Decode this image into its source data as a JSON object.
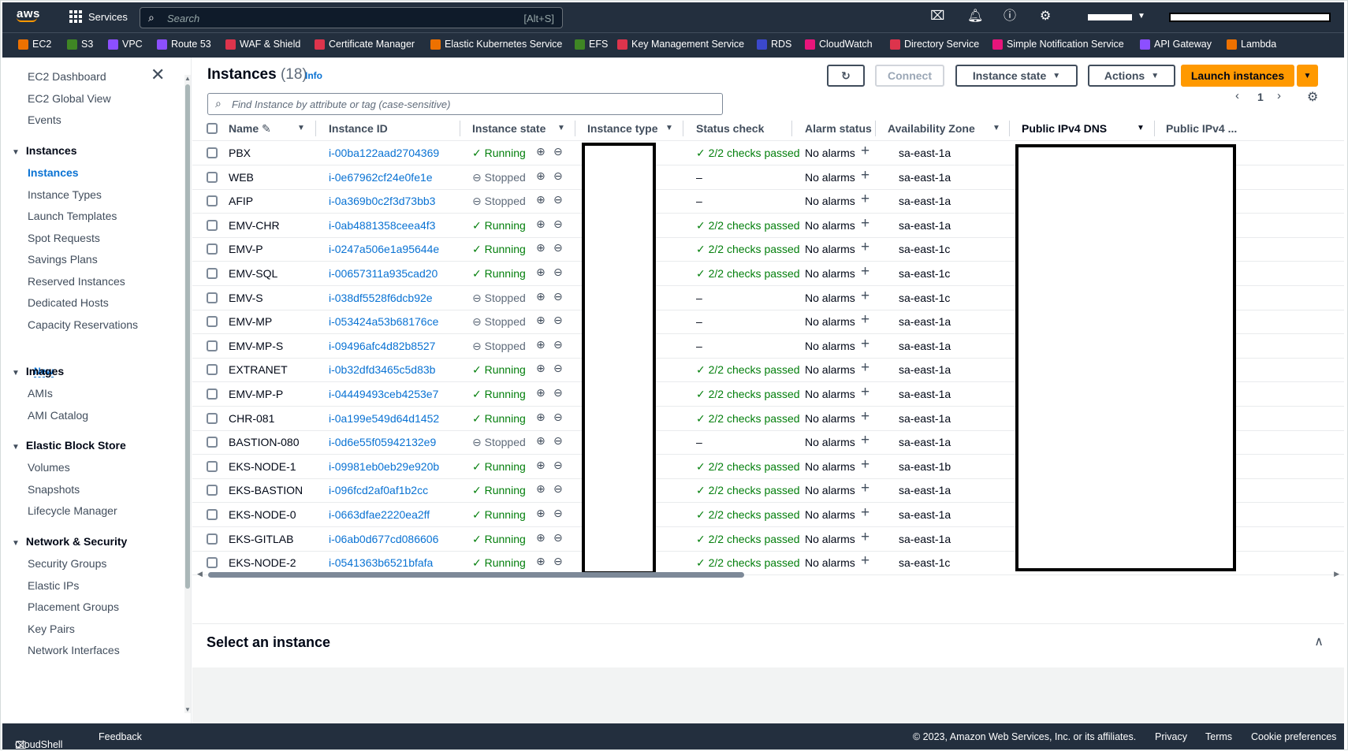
{
  "topnav": {
    "logo": "aws",
    "services_label": "Services",
    "search_placeholder": "Search",
    "search_shortcut": "[Alt+S]"
  },
  "favorites": [
    {
      "label": "EC2",
      "color": "#ed7100"
    },
    {
      "label": "S3",
      "color": "#3f8624"
    },
    {
      "label": "VPC",
      "color": "#8c4fff"
    },
    {
      "label": "Route 53",
      "color": "#8c4fff"
    },
    {
      "label": "WAF & Shield",
      "color": "#dd344c"
    },
    {
      "label": "Certificate Manager",
      "color": "#dd344c"
    },
    {
      "label": "Elastic Kubernetes Service",
      "color": "#ed7100"
    },
    {
      "label": "EFS",
      "color": "#3f8624"
    },
    {
      "label": "Key Management Service",
      "color": "#dd344c"
    },
    {
      "label": "RDS",
      "color": "#3b48cc"
    },
    {
      "label": "CloudWatch",
      "color": "#e7157b"
    },
    {
      "label": "Directory Service",
      "color": "#dd344c"
    },
    {
      "label": "Simple Notification Service",
      "color": "#e7157b"
    },
    {
      "label": "API Gateway",
      "color": "#8c4fff"
    },
    {
      "label": "Lambda",
      "color": "#ed7100"
    }
  ],
  "sidebar": {
    "top_items": [
      "EC2 Dashboard",
      "EC2 Global View",
      "Events"
    ],
    "sections": [
      {
        "title": "Instances",
        "items": [
          "Instances",
          "Instance Types",
          "Launch Templates",
          "Spot Requests",
          "Savings Plans",
          "Reserved Instances",
          "Dedicated Hosts",
          "Capacity Reservations"
        ]
      },
      {
        "title": "Images",
        "items": [
          "AMIs",
          "AMI Catalog"
        ]
      },
      {
        "title": "Elastic Block Store",
        "items": [
          "Volumes",
          "Snapshots",
          "Lifecycle Manager"
        ]
      },
      {
        "title": "Network & Security",
        "items": [
          "Security Groups",
          "Elastic IPs",
          "Placement Groups",
          "Key Pairs",
          "Network Interfaces"
        ]
      }
    ],
    "new_badge": "New",
    "active_item": "Instances"
  },
  "header": {
    "title": "Instances",
    "count": "(18)",
    "info": "Info",
    "connect": "Connect",
    "instance_state": "Instance state",
    "actions": "Actions",
    "launch": "Launch instances",
    "find_placeholder": "Find Instance by attribute or tag (case-sensitive)",
    "page": "1"
  },
  "columns": [
    "Name",
    "Instance ID",
    "Instance state",
    "Instance type",
    "Status check",
    "Alarm status",
    "Availability Zone",
    "Public IPv4 DNS",
    "Public IPv4 ..."
  ],
  "rows": [
    {
      "name": "PBX",
      "id": "i-00ba122aad2704369",
      "state": "Running",
      "status": "2/2 checks passed",
      "alarm": "No alarms",
      "az": "sa-east-1a"
    },
    {
      "name": "WEB",
      "id": "i-0e67962cf24e0fe1e",
      "state": "Stopped",
      "status": "–",
      "alarm": "No alarms",
      "az": "sa-east-1a"
    },
    {
      "name": "AFIP",
      "id": "i-0a369b0c2f3d73bb3",
      "state": "Stopped",
      "status": "–",
      "alarm": "No alarms",
      "az": "sa-east-1a"
    },
    {
      "name": "EMV-CHR",
      "id": "i-0ab4881358ceea4f3",
      "state": "Running",
      "status": "2/2 checks passed",
      "alarm": "No alarms",
      "az": "sa-east-1a"
    },
    {
      "name": "EMV-P",
      "id": "i-0247a506e1a95644e",
      "state": "Running",
      "status": "2/2 checks passed",
      "alarm": "No alarms",
      "az": "sa-east-1c"
    },
    {
      "name": "EMV-SQL",
      "id": "i-00657311a935cad20",
      "state": "Running",
      "status": "2/2 checks passed",
      "alarm": "No alarms",
      "az": "sa-east-1c"
    },
    {
      "name": "EMV-S",
      "id": "i-038df5528f6dcb92e",
      "state": "Stopped",
      "status": "–",
      "alarm": "No alarms",
      "az": "sa-east-1c"
    },
    {
      "name": "EMV-MP",
      "id": "i-053424a53b68176ce",
      "state": "Stopped",
      "status": "–",
      "alarm": "No alarms",
      "az": "sa-east-1a"
    },
    {
      "name": "EMV-MP-S",
      "id": "i-09496afc4d82b8527",
      "state": "Stopped",
      "status": "–",
      "alarm": "No alarms",
      "az": "sa-east-1a"
    },
    {
      "name": "EXTRANET",
      "id": "i-0b32dfd3465c5d83b",
      "state": "Running",
      "status": "2/2 checks passed",
      "alarm": "No alarms",
      "az": "sa-east-1a"
    },
    {
      "name": "EMV-MP-P",
      "id": "i-04449493ceb4253e7",
      "state": "Running",
      "status": "2/2 checks passed",
      "alarm": "No alarms",
      "az": "sa-east-1a"
    },
    {
      "name": "CHR-081",
      "id": "i-0a199e549d64d1452",
      "state": "Running",
      "status": "2/2 checks passed",
      "alarm": "No alarms",
      "az": "sa-east-1a"
    },
    {
      "name": "BASTION-080",
      "id": "i-0d6e55f05942132e9",
      "state": "Stopped",
      "status": "–",
      "alarm": "No alarms",
      "az": "sa-east-1a"
    },
    {
      "name": "EKS-NODE-1",
      "id": "i-09981eb0eb29e920b",
      "state": "Running",
      "status": "2/2 checks passed",
      "alarm": "No alarms",
      "az": "sa-east-1b"
    },
    {
      "name": "EKS-BASTION",
      "id": "i-096fcd2af0af1b2cc",
      "state": "Running",
      "status": "2/2 checks passed",
      "alarm": "No alarms",
      "az": "sa-east-1a"
    },
    {
      "name": "EKS-NODE-0",
      "id": "i-0663dfae2220ea2ff",
      "state": "Running",
      "status": "2/2 checks passed",
      "alarm": "No alarms",
      "az": "sa-east-1a"
    },
    {
      "name": "EKS-GITLAB",
      "id": "i-06ab0d677cd086606",
      "state": "Running",
      "status": "2/2 checks passed",
      "alarm": "No alarms",
      "az": "sa-east-1a"
    },
    {
      "name": "EKS-NODE-2",
      "id": "i-0541363b6521bfafa",
      "state": "Running",
      "status": "2/2 checks passed",
      "alarm": "No alarms",
      "az": "sa-east-1c"
    }
  ],
  "bottom_panel": {
    "title": "Select an instance"
  },
  "footer": {
    "cloudshell": "CloudShell",
    "feedback": "Feedback",
    "copyright": "© 2023, Amazon Web Services, Inc. or its affiliates.",
    "privacy": "Privacy",
    "terms": "Terms",
    "cookies": "Cookie preferences"
  },
  "colors": {
    "nav_bg": "#232f3e",
    "link": "#0972d3",
    "running": "#037f0c",
    "primary_button": "#ff9900"
  }
}
